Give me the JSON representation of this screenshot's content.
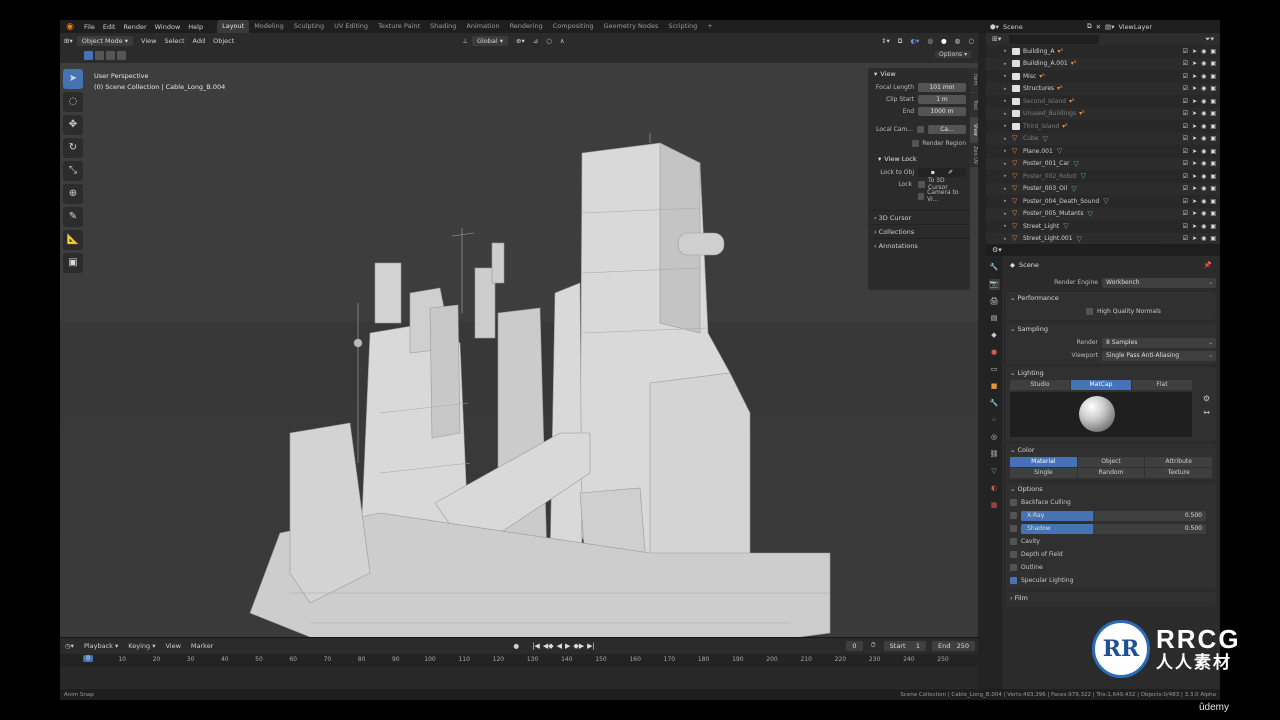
{
  "topbar": {
    "menus": [
      "File",
      "Edit",
      "Render",
      "Window",
      "Help"
    ],
    "workspaces": [
      "Layout",
      "Modeling",
      "Sculpting",
      "UV Editing",
      "Texture Paint",
      "Shading",
      "Animation",
      "Rendering",
      "Compositing",
      "Geometry Nodes",
      "Scripting"
    ],
    "active_workspace": "Layout",
    "scene_label": "Scene",
    "viewlayer_label": "ViewLayer"
  },
  "viewport_header": {
    "mode": "Object Mode",
    "menus": [
      "View",
      "Select",
      "Add",
      "Object"
    ],
    "transform_orientation": "Global",
    "options_label": "Options"
  },
  "viewport": {
    "perspective": "User Perspective",
    "collection_info": "(0) Scene Collection | Cable_Long_B.004"
  },
  "npanel": {
    "view_title": "View",
    "focal_length_label": "Focal Length",
    "focal_length_value": "101 mm",
    "clip_start_label": "Clip Start",
    "clip_start_value": "1 m",
    "clip_end_label": "End",
    "clip_end_value": "1000 m",
    "local_camera_label": "Local Cam...",
    "local_camera_value": "Ca...",
    "render_region_label": "Render Region",
    "view_lock_title": "View Lock",
    "lock_to_object_label": "Lock to Obj",
    "lock_label": "Lock",
    "to_3d_cursor_label": "To 3D Cursor",
    "camera_to_view_label": "Camera to Vi...",
    "sections": [
      "3D Cursor",
      "Collections",
      "Annotations"
    ],
    "side_tabs": [
      "Item",
      "Tool",
      "View",
      "Zen UV"
    ]
  },
  "outliner": {
    "rows": [
      {
        "name": "Building_A",
        "dim": false,
        "type": "collection"
      },
      {
        "name": "Building_A.001",
        "dim": false,
        "type": "collection"
      },
      {
        "name": "Misc",
        "dim": false,
        "type": "collection"
      },
      {
        "name": "Structures",
        "dim": false,
        "type": "collection"
      },
      {
        "name": "Second_Island",
        "dim": true,
        "type": "collection"
      },
      {
        "name": "Unused_Buildings",
        "dim": true,
        "type": "collection"
      },
      {
        "name": "Third_Island",
        "dim": true,
        "type": "collection"
      },
      {
        "name": "Cube",
        "dim": true,
        "type": "object"
      },
      {
        "name": "Plane.001",
        "dim": false,
        "type": "object"
      },
      {
        "name": "Poster_001_Car",
        "dim": false,
        "type": "object"
      },
      {
        "name": "Poster_002_Robot",
        "dim": true,
        "type": "object"
      },
      {
        "name": "Poster_003_Oil",
        "dim": false,
        "type": "object"
      },
      {
        "name": "Poster_004_Death_Sound",
        "dim": false,
        "type": "object"
      },
      {
        "name": "Poster_005_Mutants",
        "dim": false,
        "type": "object"
      },
      {
        "name": "Street_Light",
        "dim": false,
        "type": "object"
      },
      {
        "name": "Street_Light.001",
        "dim": false,
        "type": "object"
      }
    ]
  },
  "properties": {
    "context_title": "Scene",
    "render_engine_label": "Render Engine",
    "render_engine_value": "Workbench",
    "performance_title": "Performance",
    "high_quality_normals_label": "High Quality Normals",
    "sampling_title": "Sampling",
    "render_label": "Render",
    "render_value": "8 Samples",
    "viewport_label": "Viewport",
    "viewport_value": "Single Pass Anti-Aliasing",
    "lighting_title": "Lighting",
    "lighting_modes": [
      "Studio",
      "MatCap",
      "Flat"
    ],
    "lighting_active": 1,
    "color_title": "Color",
    "color_modes": [
      "Material",
      "Object",
      "Attribute",
      "Single",
      "Random",
      "Texture"
    ],
    "color_active": 0,
    "options_title": "Options",
    "backface_culling_label": "Backface Culling",
    "xray_label": "X-Ray",
    "xray_value": "0.500",
    "shadow_label": "Shadow",
    "shadow_value": "0.500",
    "cavity_label": "Cavity",
    "dof_label": "Depth of Field",
    "outline_label": "Outline",
    "specular_label": "Specular Lighting",
    "film_title": "Film"
  },
  "timeline": {
    "menus": [
      "Playback",
      "Keying",
      "View",
      "Marker"
    ],
    "current_frame": "0",
    "start_label": "Start",
    "start_value": "1",
    "end_label": "End",
    "end_value": "250",
    "ruler": [
      "10",
      "20",
      "30",
      "40",
      "50",
      "60",
      "70",
      "80",
      "90",
      "100",
      "110",
      "120",
      "130",
      "140",
      "150",
      "160",
      "170",
      "180",
      "190",
      "200",
      "210",
      "220",
      "230",
      "240",
      "250"
    ],
    "cursor_label": "0"
  },
  "statusbar": {
    "left": "Anim Snap",
    "right": "Scene Collection | Cable_Long_B.004 | Verts:493,396 | Faces:979,322 | Tris:1,649,432 | Objects:0/483 | 3.3.0 Alpha"
  },
  "watermark": {
    "logo_text": "RR",
    "brand": "RRCG",
    "brand_cn": "人人素材",
    "udemy": "ûdemy"
  }
}
